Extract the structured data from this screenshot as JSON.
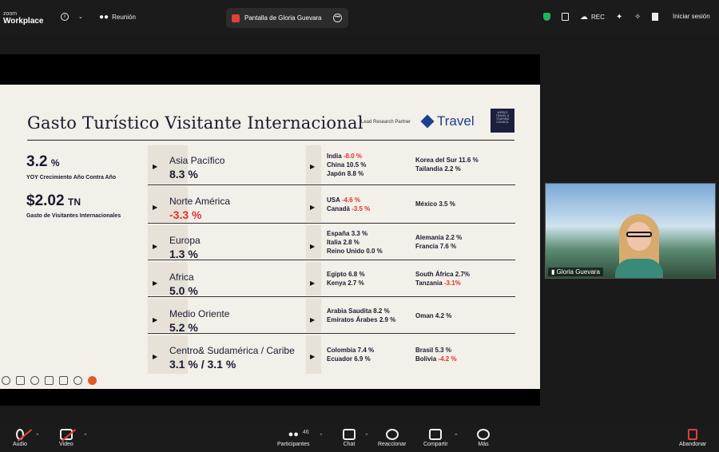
{
  "top": {
    "logo_l1": "zoom",
    "logo_l2": "Workplace",
    "info_icon": "info-icon",
    "meeting_label": "Reunión",
    "share_label": "Pantalla de Gloria Guevara",
    "rec_label": "REC",
    "signin_label": "Iniciar sesión"
  },
  "slide": {
    "title": "Gasto Turístico Visitante Internacional",
    "partner_label": "Lead Research Partner",
    "travel_label": "Travel",
    "wttc_label": "WORLD TRAVEL & TOURISM COUNCIL",
    "kpis": [
      {
        "num": "3.2",
        "unit": "%",
        "label": "YOY Crecimiento Año Contra Año"
      },
      {
        "num": "$2.02",
        "unit": "TN",
        "label": "Gasto de Visitantes Internacionales"
      }
    ],
    "regions": [
      {
        "name": "Asia Pacífico",
        "pct": "8.3 %",
        "negative": false,
        "col1": [
          [
            "India ",
            "-8.0 %",
            true
          ],
          [
            "China ",
            "10.5 %",
            false
          ],
          [
            "Japón ",
            "8.8 %",
            false
          ]
        ],
        "col2": [
          [
            "Korea del Sur ",
            "11.6 %",
            false
          ],
          [
            "Tailandia ",
            "2.2 %",
            false
          ]
        ]
      },
      {
        "name": "Norte América",
        "pct": "-3.3 %",
        "negative": true,
        "col1": [
          [
            "USA ",
            "-4.6 %",
            true
          ],
          [
            "Canadá ",
            "-3.5 %",
            true
          ]
        ],
        "col2": [
          [
            "México ",
            "3.5 %",
            false
          ]
        ]
      },
      {
        "name": "Europa",
        "pct": "1.3 %",
        "negative": false,
        "col1": [
          [
            "España ",
            "3.3 %",
            false
          ],
          [
            "Italia ",
            "2.8 %",
            false
          ],
          [
            "Reino Unido ",
            "0.0 %",
            false
          ]
        ],
        "col2": [
          [
            "Alemania ",
            "2.2 %",
            false
          ],
          [
            "Francia ",
            "7.6 %",
            false
          ]
        ]
      },
      {
        "name": "Africa",
        "pct": "5.0 %",
        "negative": false,
        "col1": [
          [
            "Egipto ",
            "6.8 %",
            false
          ],
          [
            "Kenya ",
            "2.7 %",
            false
          ]
        ],
        "col2": [
          [
            "South África ",
            "2.7%",
            false
          ],
          [
            "Tanzania ",
            "-3.1%",
            true
          ]
        ]
      },
      {
        "name": "Medio Oriente",
        "pct": "5.2 %",
        "negative": false,
        "col1": [
          [
            "Arabia Saudita ",
            "8.2 %",
            false
          ],
          [
            "Emiratos Árabes ",
            "2.9 %",
            false
          ]
        ],
        "col2": [
          [
            "Oman ",
            "4.2 %",
            false
          ]
        ]
      },
      {
        "name": "Centro& Sudamérica / Caribe",
        "pct": "3.1 % / 3.1 %",
        "negative": false,
        "col1": [
          [
            "Colombia ",
            "7.4 %",
            false
          ],
          [
            "Ecuador ",
            "6.9 %",
            false
          ]
        ],
        "col2": [
          [
            "Brasil ",
            "5.3 %",
            false
          ],
          [
            "Bolivia ",
            "-4.2 %",
            true
          ]
        ]
      }
    ]
  },
  "video": {
    "name": "Gloria Guevara"
  },
  "bottom": {
    "audio": "Audio",
    "video": "Video",
    "participants": "Participantes",
    "participants_count": "46",
    "chat": "Chat",
    "react": "Reaccionar",
    "share": "Compartir",
    "more": "Más",
    "leave": "Abandonar"
  },
  "colors": {
    "negative": "#e0302b",
    "navy": "#1a1a2e",
    "slide_bg": "#f3efe9",
    "band": "#e7e1d7"
  }
}
